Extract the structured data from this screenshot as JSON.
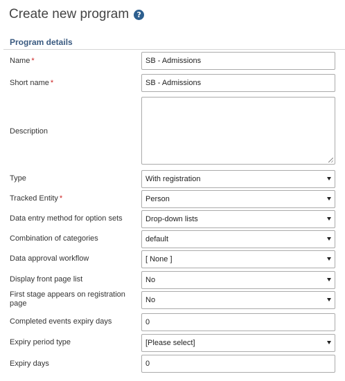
{
  "page": {
    "title": "Create new program",
    "help_icon": "?"
  },
  "section": {
    "title": "Program details"
  },
  "required_mark": "*",
  "fields": {
    "name": {
      "label": "Name",
      "value": "SB - Admissions"
    },
    "short_name": {
      "label": "Short name",
      "value": "SB - Admissions"
    },
    "description": {
      "label": "Description",
      "value": ""
    },
    "type": {
      "label": "Type",
      "value": "With registration"
    },
    "tracked_entity": {
      "label": "Tracked Entity",
      "value": "Person"
    },
    "data_entry_method": {
      "label": "Data entry method for option sets",
      "value": "Drop-down lists"
    },
    "category_combo": {
      "label": "Combination of categories",
      "value": "default"
    },
    "approval_workflow": {
      "label": "Data approval workflow",
      "value": "[ None ]"
    },
    "front_page_list": {
      "label": "Display front page list",
      "value": "No"
    },
    "first_stage_registration": {
      "label": "First stage appears on registration page",
      "value": "No"
    },
    "completed_events_expiry": {
      "label": "Completed events expiry days",
      "value": "0"
    },
    "expiry_period_type": {
      "label": "Expiry period type",
      "value": "[Please select]"
    },
    "expiry_days": {
      "label": "Expiry days",
      "value": "0"
    }
  }
}
